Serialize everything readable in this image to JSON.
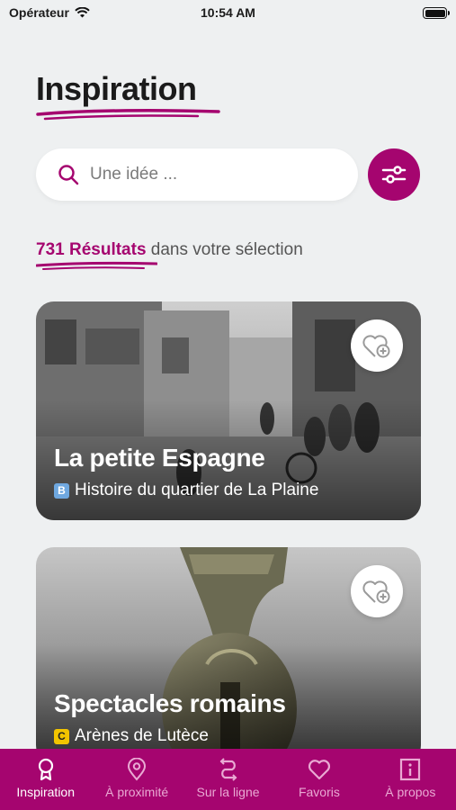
{
  "status_bar": {
    "carrier": "Opérateur",
    "time": "10:54 AM"
  },
  "page_title": "Inspiration",
  "search": {
    "placeholder": "Une idée ..."
  },
  "results": {
    "count": "731 Résultats",
    "suffix": " dans votre sélection"
  },
  "cards": [
    {
      "title": "La petite Espagne",
      "line": "B",
      "line_color": "#6fa8e0",
      "subtitle": "Histoire du quartier de La Plaine"
    },
    {
      "title": "Spectacles romains",
      "line": "C",
      "line_color": "#f2c400",
      "subtitle": "Arènes de Lutèce"
    }
  ],
  "tabs": [
    {
      "label": "Inspiration",
      "icon": "ribbon-icon",
      "active": true
    },
    {
      "label": "À proximité",
      "icon": "location-pin-icon",
      "active": false
    },
    {
      "label": "Sur la ligne",
      "icon": "route-icon",
      "active": false
    },
    {
      "label": "Favoris",
      "icon": "heart-icon",
      "active": false
    },
    {
      "label": "À propos",
      "icon": "info-icon",
      "active": false
    }
  ],
  "colors": {
    "accent": "#a5056f",
    "background": "#eef0f1"
  }
}
